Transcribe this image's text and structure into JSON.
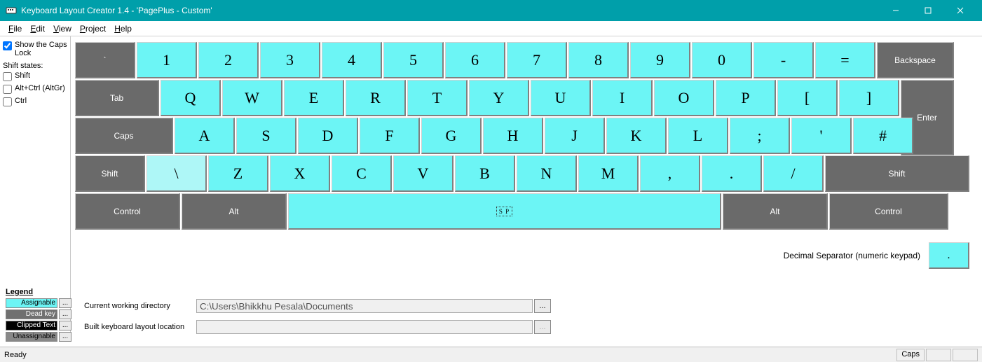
{
  "window": {
    "title": "Keyboard Layout Creator 1.4 - 'PagePlus - Custom'"
  },
  "menu": {
    "items": [
      "File",
      "Edit",
      "View",
      "Project",
      "Help"
    ]
  },
  "sidebar": {
    "show_caps": "Show the Caps Lock",
    "shift_states_label": "Shift states:",
    "opt_shift": "Shift",
    "opt_altgr": "Alt+Ctrl (AltGr)",
    "opt_ctrl": "Ctrl"
  },
  "keys": {
    "row0": {
      "grave": "`",
      "k1": "1",
      "k2": "2",
      "k3": "3",
      "k4": "4",
      "k5": "5",
      "k6": "6",
      "k7": "7",
      "k8": "8",
      "k9": "9",
      "k0": "0",
      "minus": "-",
      "equal": "=",
      "backspace": "Backspace"
    },
    "row1": {
      "tab": "Tab",
      "q": "Q",
      "w": "W",
      "e": "E",
      "r": "R",
      "t": "T",
      "y": "Y",
      "u": "U",
      "i": "I",
      "o": "O",
      "p": "P",
      "lbr": "[",
      "rbr": "]",
      "enter": "Enter"
    },
    "row2": {
      "caps": "Caps",
      "a": "A",
      "s": "S",
      "d": "D",
      "f": "F",
      "g": "G",
      "h": "H",
      "j": "J",
      "k": "K",
      "l": "L",
      "semi": ";",
      "apos": "'",
      "hash": "#"
    },
    "row3": {
      "lshift": "Shift",
      "bslash": "\\",
      "z": "Z",
      "x": "X",
      "c": "C",
      "v": "V",
      "b": "B",
      "n": "N",
      "m": "M",
      "comma": ",",
      "period": ".",
      "slash": "/",
      "rshift": "Shift"
    },
    "row4": {
      "lctrl": "Control",
      "lalt": "Alt",
      "space": "S P",
      "ralt": "Alt",
      "rctrl": "Control"
    },
    "dec_label": "Decimal Separator (numeric keypad)",
    "dec_key": "."
  },
  "legend": {
    "title": "Legend",
    "assignable": "Assignable",
    "deadkey": "Dead key",
    "clipped": "Clipped Text",
    "unassignable": "Unassignable",
    "btn": "..."
  },
  "paths": {
    "cwd_label": "Current working directory",
    "cwd_value": "C:\\Users\\Bhikkhu Pesala\\Documents",
    "build_label": "Built keyboard layout location",
    "build_value": "",
    "btn": "..."
  },
  "status": {
    "ready": "Ready",
    "caps": "Caps"
  }
}
